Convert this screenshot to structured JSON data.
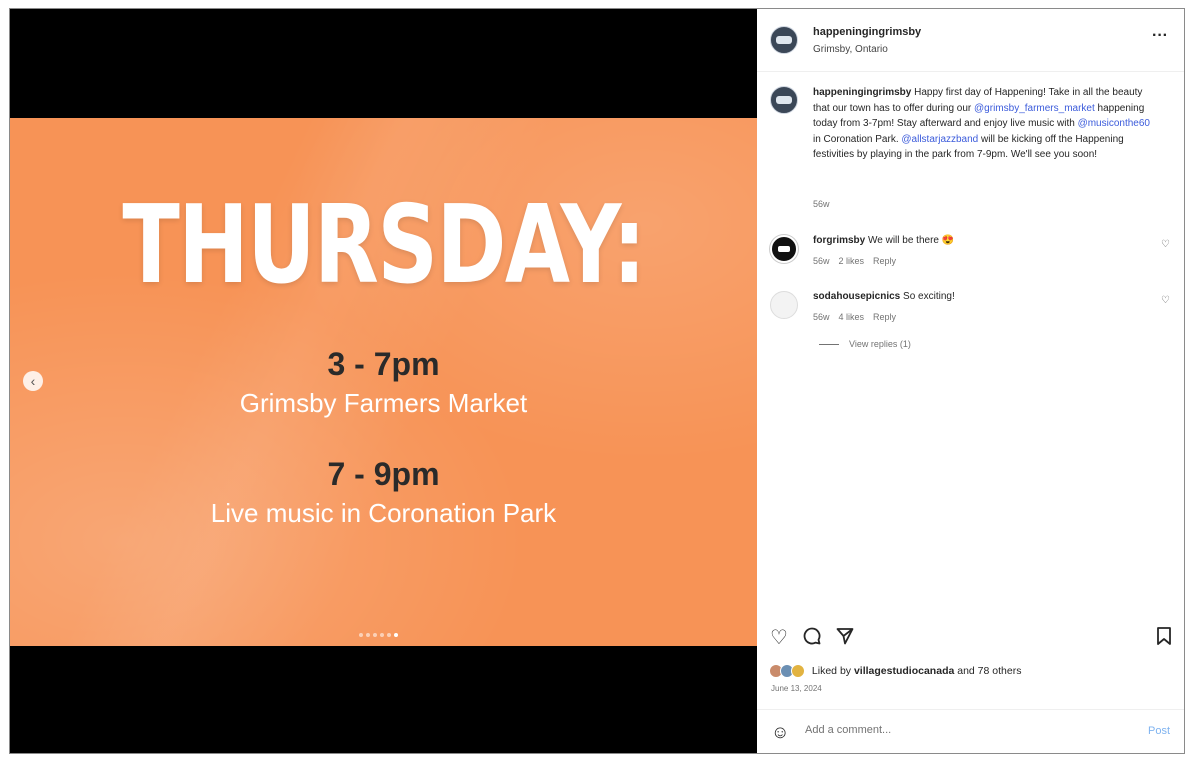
{
  "slide": {
    "headline": "THURSDAY:",
    "events": [
      {
        "time": "3 - 7pm",
        "description": "Grimsby Farmers Market"
      },
      {
        "time": "7 - 9pm",
        "description": "Live music in Coronation Park"
      }
    ],
    "carousel": {
      "total": 6,
      "active_index": 5
    },
    "prev_icon": "chevron-left-icon",
    "background_color": "#f79356"
  },
  "post": {
    "username": "happeningingrimsby",
    "location": "Grimsby, Ontario",
    "more_icon": "more-options-icon",
    "caption": {
      "author": "happeningingrimsby",
      "text_1": " Happy first day of Happening! Take in all the beauty that our town has to offer during our ",
      "mention_1": "@grimsby_farmers_market",
      "text_2": " happening today from 3-7pm! Stay afterward and enjoy live music with ",
      "mention_2": "@musiconthe60",
      "text_3": " in Coronation Park. ",
      "mention_3": "@allstarjazzband",
      "text_4": " will be kicking off the Happening festivities by playing in the park from 7-9pm. We'll see you soon!",
      "age": "56w"
    },
    "comments": [
      {
        "user": "forgrimsby",
        "text": "We will be there 😍",
        "age": "56w",
        "likes": "2 likes",
        "reply": "Reply"
      },
      {
        "user": "sodahousepicnics",
        "text": "So exciting!",
        "age": "56w",
        "likes": "4 likes",
        "reply": "Reply"
      }
    ],
    "view_replies": "View replies (1)",
    "likes": {
      "liked_by_prefix": "Liked by ",
      "liked_by_user": "villagestudiocanada",
      "others": " and 78 others"
    },
    "date": "June 13, 2024",
    "add_comment": {
      "placeholder": "Add a comment...",
      "post_label": "Post"
    }
  },
  "icons": {
    "like": "heart-icon",
    "comment": "comment-icon",
    "share": "share-icon",
    "save": "bookmark-icon",
    "emoji": "emoji-icon"
  },
  "colors": {
    "link": "#3b5bdb",
    "post_button": "#7fb3f0"
  }
}
